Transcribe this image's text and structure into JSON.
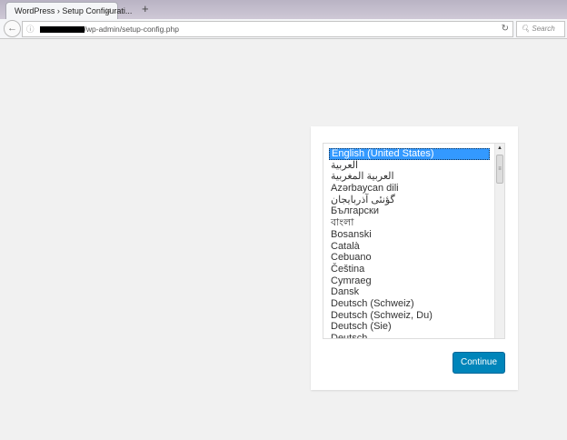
{
  "browser": {
    "tab_title": "WordPress › Setup Configurati...",
    "url": "/wp-admin/setup-config.php",
    "search_placeholder": "Search"
  },
  "setup": {
    "languages": [
      "English (United States)",
      "العربية",
      "العربية المغربية",
      "Azərbaycan dili",
      "گؤنئی آذربایجان",
      "Български",
      "বাংলা",
      "Bosanski",
      "Català",
      "Cebuano",
      "Čeština",
      "Cymraeg",
      "Dansk",
      "Deutsch (Schweiz)",
      "Deutsch (Schweiz, Du)",
      "Deutsch (Sie)",
      "Deutsch"
    ],
    "selected": "English (United States)",
    "continue_label": "Continue"
  },
  "colors": {
    "accent": "#0085ba",
    "selection": "#3399ff"
  }
}
